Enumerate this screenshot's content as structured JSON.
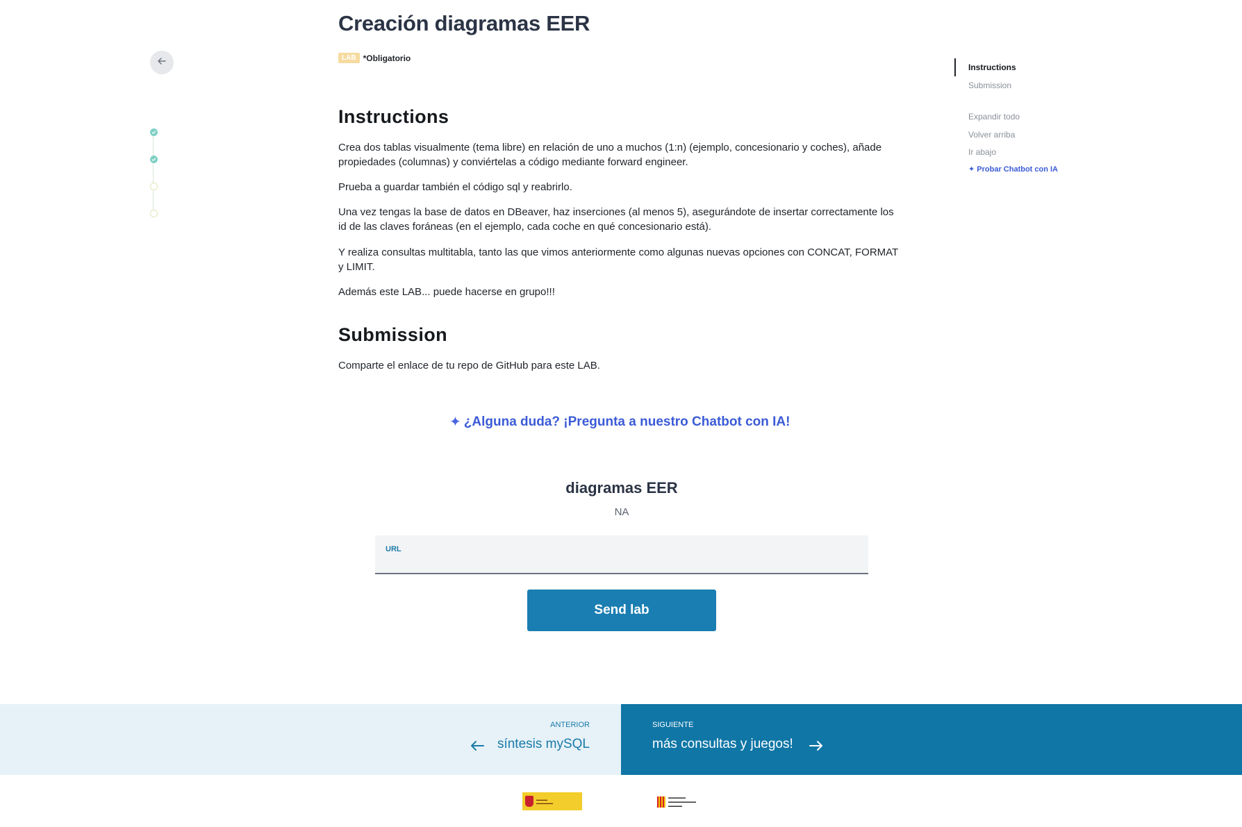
{
  "page": {
    "title": "Creación diagramas EER",
    "badge": "LAB",
    "mandatory": "*Obligatorio"
  },
  "instructions": {
    "heading": "Instructions",
    "paragraphs": [
      "Crea dos tablas visualmente (tema libre) en relación de uno a muchos (1:n) (ejemplo, concesionario y coches), añade propiedades (columnas) y conviértelas a código mediante forward engineer.",
      "Prueba a guardar también el código sql y reabrirlo.",
      "Una vez tengas la base de datos en DBeaver, haz inserciones (al menos 5), asegurándote de insertar correctamente los id de las claves foráneas (en el ejemplo, cada coche en qué concesionario está).",
      "Y realiza consultas multitabla, tanto las que vimos anteriormente como algunas nuevas opciones con CONCAT, FORMAT y LIMIT.",
      "Además este LAB... puede hacerse en grupo!!!"
    ]
  },
  "submission": {
    "heading": "Submission",
    "text": "Comparte el enlace de tu repo de GitHub para este LAB."
  },
  "chatbot": {
    "cta": "¿Alguna duda? ¡Pregunta a nuestro Chatbot con IA!",
    "icon": "sparkle-icon"
  },
  "form": {
    "title": "diagramas EER",
    "subtitle": "NA",
    "url_label": "URL",
    "url_value": "",
    "submit_label": "Send lab"
  },
  "toc": {
    "items": [
      {
        "label": "Instructions",
        "active": true
      },
      {
        "label": "Submission",
        "active": false
      }
    ],
    "actions": [
      "Expandir todo",
      "Volver arriba",
      "Ir abajo"
    ],
    "ai_link": "Probar Chatbot con IA"
  },
  "progress": {
    "steps": [
      "done",
      "done",
      "pending",
      "pending"
    ]
  },
  "nav": {
    "prev_kicker": "ANTERIOR",
    "prev_title": "síntesis mySQL",
    "next_kicker": "SIGUIENTE",
    "next_title": "más consultas y juegos!"
  },
  "colors": {
    "primary": "#1a7eb2",
    "next_bg": "#0f76a6",
    "prev_bg": "#e6f1f8",
    "badge": "#f6dba0",
    "step_done": "#7fd0c4",
    "ai": "#3b5bd6"
  }
}
